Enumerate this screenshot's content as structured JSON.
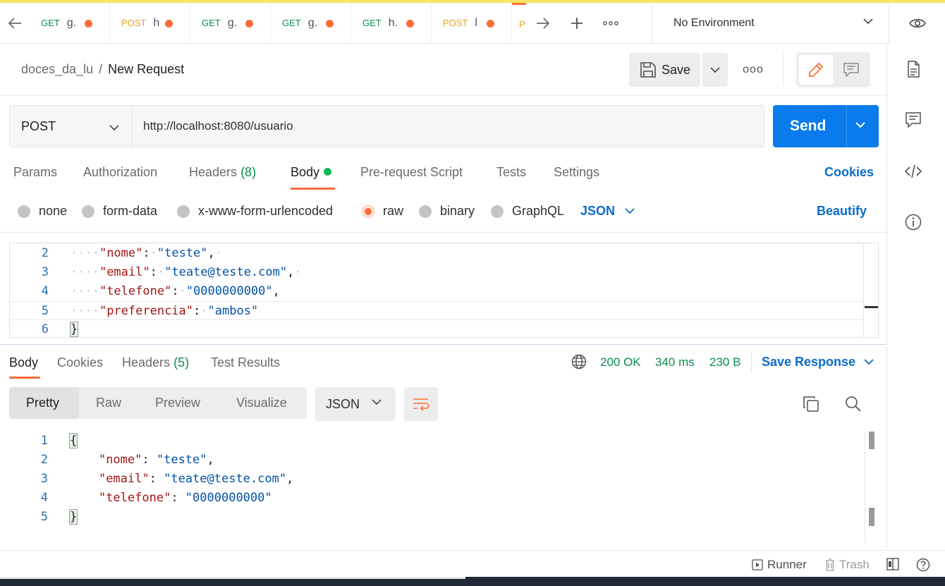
{
  "tabs": [
    {
      "method": "GET",
      "name": "g."
    },
    {
      "method": "POST",
      "name": "h"
    },
    {
      "method": "GET",
      "name": "g."
    },
    {
      "method": "GET",
      "name": "g."
    },
    {
      "method": "GET",
      "name": "h."
    },
    {
      "method": "POST",
      "name": "l"
    },
    {
      "method": "P",
      "name": ""
    }
  ],
  "environment": "No Environment",
  "breadcrumb": {
    "collection": "doces_da_lu",
    "separator": "/",
    "request": "New Request"
  },
  "toolbar": {
    "save_label": "Save",
    "more": "ooo"
  },
  "request": {
    "method": "POST",
    "url": "http://localhost:8080/usuario",
    "send_label": "Send"
  },
  "request_tabs": {
    "params": "Params",
    "authorization": "Authorization",
    "headers": "Headers",
    "headers_count": "(8)",
    "body": "Body",
    "prerequest": "Pre-request Script",
    "tests": "Tests",
    "settings": "Settings",
    "cookies": "Cookies"
  },
  "body_types": {
    "none": "none",
    "form_data": "form-data",
    "urlencoded": "x-www-form-urlencoded",
    "raw": "raw",
    "binary": "binary",
    "graphql": "GraphQL",
    "language": "JSON",
    "beautify": "Beautify"
  },
  "request_body": {
    "ln2": "2",
    "ln3": "3",
    "ln4": "4",
    "ln5": "5",
    "ln6": "6",
    "k_nome": "\"nome\"",
    "v_nome": "\"teste\"",
    "k_email": "\"email\"",
    "v_email": "\"teate@teste.com\"",
    "k_tel": "\"telefone\"",
    "v_tel": "\"0000000000\"",
    "k_pref": "\"preferencia\"",
    "v_pref": "\"ambos\"",
    "close": "}"
  },
  "response_tabs": {
    "body": "Body",
    "cookies": "Cookies",
    "headers": "Headers",
    "headers_count": "(5)",
    "test_results": "Test Results",
    "status": "200 OK",
    "time": "340 ms",
    "size": "230 B",
    "save_response": "Save Response"
  },
  "response_format": {
    "pretty": "Pretty",
    "raw": "Raw",
    "preview": "Preview",
    "visualize": "Visualize",
    "language": "JSON"
  },
  "response_body": {
    "ln1": "1",
    "ln2": "2",
    "ln3": "3",
    "ln4": "4",
    "ln5": "5",
    "open": "{",
    "k_nome": "\"nome\"",
    "v_nome": "\"teste\"",
    "k_email": "\"email\"",
    "v_email": "\"teate@teste.com\"",
    "k_tel": "\"telefone\"",
    "v_tel": "\"0000000000\"",
    "close": "}"
  },
  "statusbar": {
    "runner": "Runner",
    "trash": "Trash"
  }
}
